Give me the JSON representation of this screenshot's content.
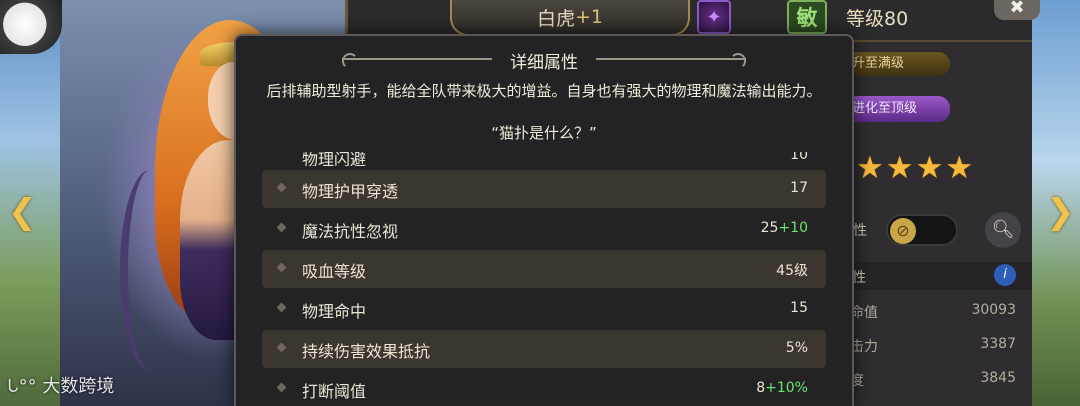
{
  "header": {
    "hero_name": "白虎",
    "hero_plus": "+1",
    "attribute_badge": "敏",
    "level_label": "等级80",
    "close_label": "✖"
  },
  "side_actions": {
    "upgrade_max_level": "升至满级",
    "evolve_max": "进化至顶级",
    "stars": "★★★★",
    "toggle_label": "性"
  },
  "stats_panel": {
    "section_label": "性",
    "rows": [
      {
        "label": "命值",
        "value": "30093"
      },
      {
        "label": "击力",
        "value": "3387"
      },
      {
        "label": "度",
        "value": "3845"
      }
    ]
  },
  "watermark": "大数跨境",
  "modal": {
    "title": "详细属性",
    "description": "后排辅助型射手，能给全队带来极大的增益。自身也有强大的物理和魔法输出能力。",
    "quote": "“猫扑是什么？”",
    "cut_row": {
      "name": "物理闪避",
      "value": "10"
    },
    "rows": [
      {
        "name": "物理护甲穿透",
        "base": "17",
        "bonus": ""
      },
      {
        "name": "魔法抗性忽视",
        "base": "25",
        "bonus": "+10"
      },
      {
        "name": "吸血等级",
        "base": "45级",
        "bonus": ""
      },
      {
        "name": "物理命中",
        "base": "15",
        "bonus": ""
      },
      {
        "name": "持续伤害效果抵抗",
        "base": "5%",
        "bonus": ""
      },
      {
        "name": "打断阈值",
        "base": "8",
        "bonus": "+10%"
      }
    ]
  }
}
